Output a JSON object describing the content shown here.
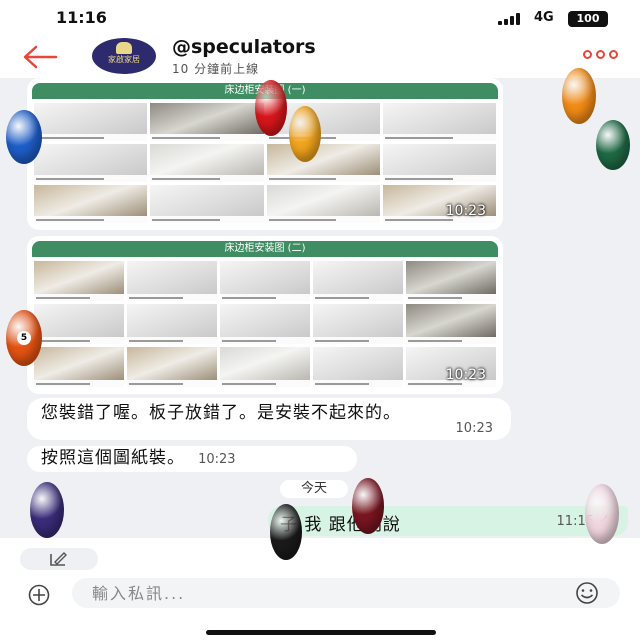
{
  "status_bar": {
    "time": "11:16",
    "network": "4G",
    "battery": "100"
  },
  "header": {
    "contact_name": "@speculators",
    "contact_status": "10 分鐘前上線",
    "avatar_text": "家啟家居"
  },
  "messages": {
    "image1": {
      "banner": "床边柜安装图 (一)",
      "time": "10:23"
    },
    "image2": {
      "banner": "床边柜安装图 (二)",
      "time": "10:23"
    },
    "text1": {
      "text": "您裝錯了喔。板子放錯了。是安裝不起來的。",
      "time": "10:23"
    },
    "text2": {
      "text": "按照這個圖紙裝。",
      "time": "10:23"
    },
    "date_divider": "今天",
    "outgoing": {
      "text": "子 我  跟他們說",
      "time": "11:15",
      "status_icon": "check-icon"
    }
  },
  "composer": {
    "placeholder": "輸入私訊..."
  },
  "overlay_balls": [
    {
      "color": "#1e5ec8",
      "number": ""
    },
    {
      "color": "#d8161b",
      "number": ""
    },
    {
      "color": "#f2a51c",
      "number": ""
    },
    {
      "color": "#f28c17",
      "number": ""
    },
    {
      "color": "#1f6a45",
      "number": ""
    },
    {
      "color": "#e55313",
      "number": "5"
    },
    {
      "color": "#3a2c7a",
      "number": ""
    },
    {
      "color": "#1a1a1a",
      "number": ""
    },
    {
      "color": "#7a1520",
      "number": ""
    },
    {
      "color": "#f1d6e0",
      "number": ""
    }
  ]
}
